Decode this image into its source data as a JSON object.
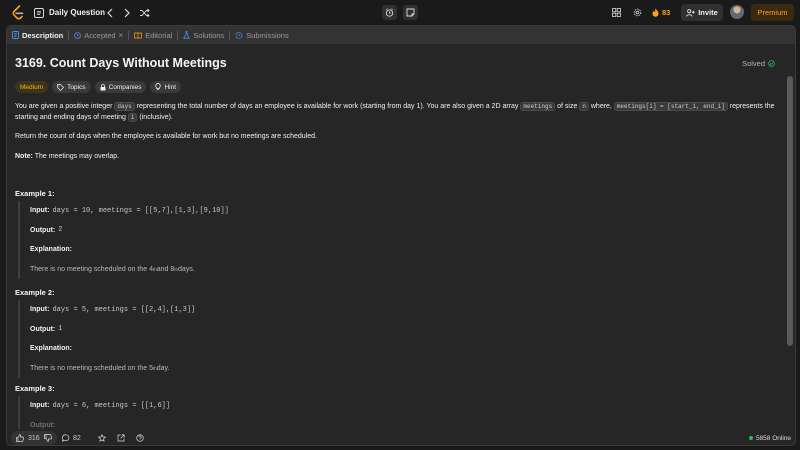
{
  "topbar": {
    "daily_label": "Daily Question",
    "streak_count": "83",
    "invite_label": "Invite",
    "premium_label": "Premium"
  },
  "tabs": [
    {
      "label": "Description",
      "active": true
    },
    {
      "label": "Accepted"
    },
    {
      "label": "Editorial"
    },
    {
      "label": "Solutions"
    },
    {
      "label": "Submissions"
    }
  ],
  "problem": {
    "title": "3169. Count Days Without Meetings",
    "status": "Solved",
    "difficulty": "Medium",
    "tags": [
      "Topics",
      "Companies",
      "Hint"
    ],
    "desc": {
      "p1_a": "You are given a positive integer ",
      "p1_code1": "days",
      "p1_b": " representing the total number of days an employee is available for work (starting from day 1). You are also given a 2D array ",
      "p1_code2": "meetings",
      "p1_c": " of size ",
      "p1_code3": "n",
      "p1_d": " where, ",
      "p1_code4": "meetings[i] = [start_i, end_i]",
      "p1_e": " represents the starting and ending days of meeting ",
      "p1_code5": "i",
      "p1_f": " (inclusive).",
      "p2": "Return the count of days when the employee is available for work but no meetings are scheduled.",
      "note_label": "Note:",
      "note_text": " The meetings may overlap."
    },
    "examples": [
      {
        "title": "Example 1:",
        "input": "days = 10, meetings = [[5,7],[1,3],[9,10]]",
        "output": "2",
        "expl_a": "There is no meeting scheduled on the 4",
        "expl_sup1": "th",
        "expl_b": " and 8",
        "expl_sup2": "th",
        "expl_c": " days."
      },
      {
        "title": "Example 2:",
        "input": "days = 5, meetings = [[2,4],[1,3]]",
        "output": "1",
        "expl_a": "There is no meeting scheduled on the 5",
        "expl_sup1": "th",
        "expl_b": " day."
      },
      {
        "title": "Example 3:",
        "input": "days = 6, meetings = [[1,6]]"
      }
    ],
    "labels": {
      "input": "Input:",
      "output": "Output:",
      "explanation": "Explanation:"
    }
  },
  "footer": {
    "likes": "316",
    "comments": "82",
    "online": "5858 Online"
  }
}
